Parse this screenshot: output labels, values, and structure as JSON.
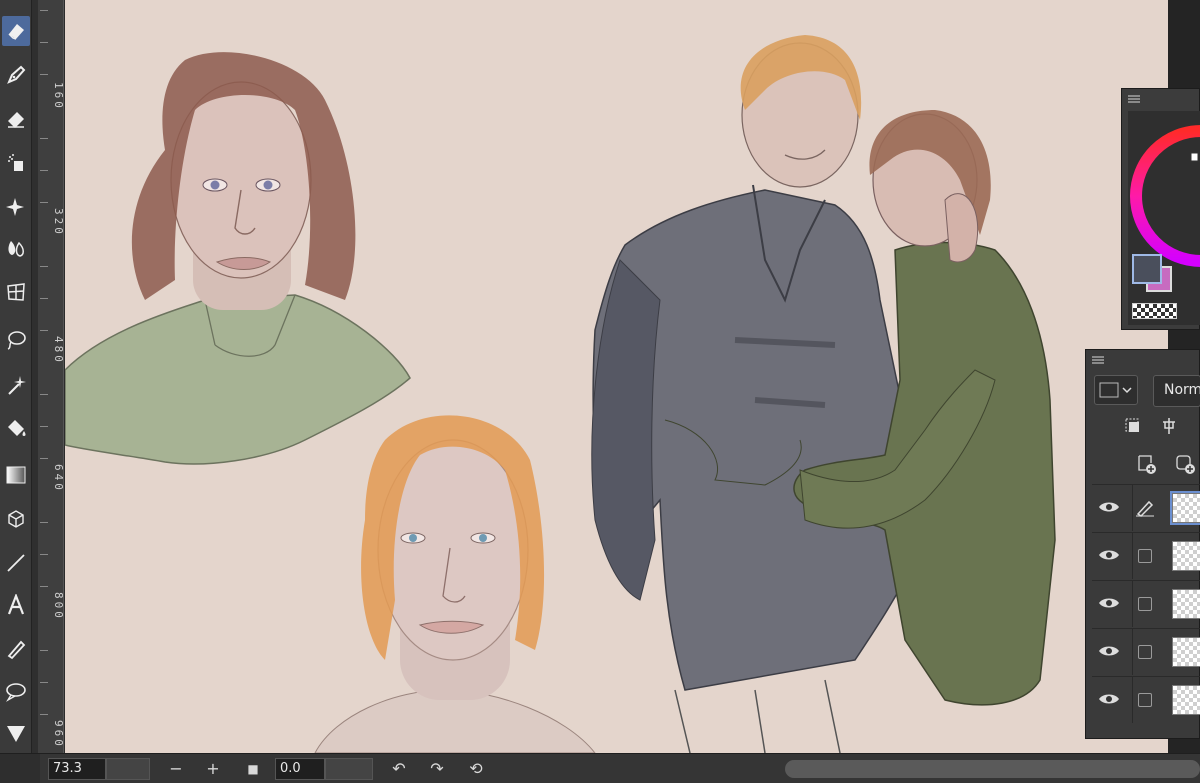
{
  "toolbar": {
    "tools": [
      {
        "name": "eraser-icon",
        "active": true
      },
      {
        "name": "pen-icon"
      },
      {
        "name": "eraser-alt-icon"
      },
      {
        "name": "airbrush-icon"
      },
      {
        "name": "sparkle-icon"
      },
      {
        "name": "blend-icon"
      },
      {
        "name": "mesh-icon"
      },
      {
        "name": "lasso-icon"
      },
      {
        "name": "magic-wand-icon"
      },
      {
        "name": "fill-bucket-icon"
      },
      {
        "name": "gradient-icon"
      },
      {
        "name": "3d-cube-icon"
      },
      {
        "name": "line-icon"
      },
      {
        "name": "text-icon"
      },
      {
        "name": "correction-pen-icon"
      },
      {
        "name": "speech-balloon-icon"
      },
      {
        "name": "frame-icon"
      }
    ]
  },
  "ruler": {
    "labels": [
      "160",
      "320",
      "480",
      "640",
      "800",
      "960"
    ]
  },
  "color_panel": {
    "main_color": "#4a4f5c",
    "sub_color": "#c76bc0"
  },
  "layer_panel": {
    "blend_mode": "Norm",
    "layers": [
      {
        "visible": true,
        "edit": true,
        "selected": true
      },
      {
        "visible": true
      },
      {
        "visible": true
      },
      {
        "visible": true
      },
      {
        "visible": true
      }
    ]
  },
  "bottom_bar": {
    "zoom": "73.3",
    "zoom_out": "−",
    "zoom_in": "+",
    "fit": "■",
    "angle": "0.0",
    "rotate_left": "↶",
    "rotate_right": "↷",
    "reset_rotate": "⟲"
  }
}
